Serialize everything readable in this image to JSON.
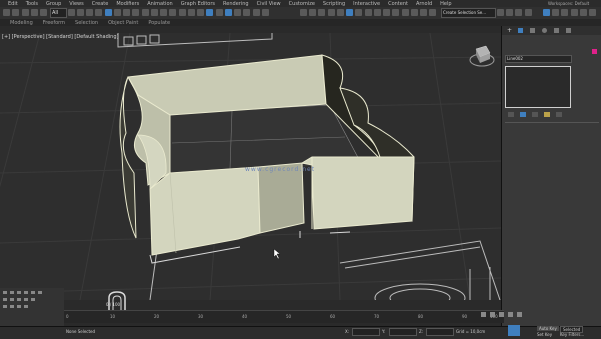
{
  "menu": {
    "items": [
      "Edit",
      "Tools",
      "Group",
      "Views",
      "Create",
      "Modifiers",
      "Animation",
      "Graph Editors",
      "Rendering",
      "Civil View",
      "Customize",
      "Scripting",
      "Interactive",
      "Content",
      "Arnold",
      "Help"
    ],
    "workspace_label": "Workspaces: Default"
  },
  "toolbar": {
    "selection_filter": "All",
    "named_selection": "Create Selection Se..."
  },
  "ribbon": {
    "tabs": [
      "Modeling",
      "Freeform",
      "Selection",
      "Object Paint",
      "Populate"
    ]
  },
  "viewport": {
    "label": "[+] [Perspective] [Standard] [Default Shading]",
    "watermark": "www.cgrecord.net"
  },
  "command_panel": {
    "object_name": "Line002",
    "color": "#e0218a"
  },
  "timeline": {
    "frame_counter": "0 / 100",
    "ticks": [
      "0",
      "10",
      "20",
      "30",
      "40",
      "50",
      "60",
      "70",
      "80",
      "90",
      "100"
    ]
  },
  "status": {
    "selected": "None Selected",
    "x_label": "X:",
    "y_label": "Y:",
    "z_label": "Z:",
    "grid": "Grid = 10,0cm",
    "auto_key": "Auto Key",
    "selected_btn": "Selected",
    "set_key": "Set Key",
    "key_filters": "Key Filters..."
  }
}
